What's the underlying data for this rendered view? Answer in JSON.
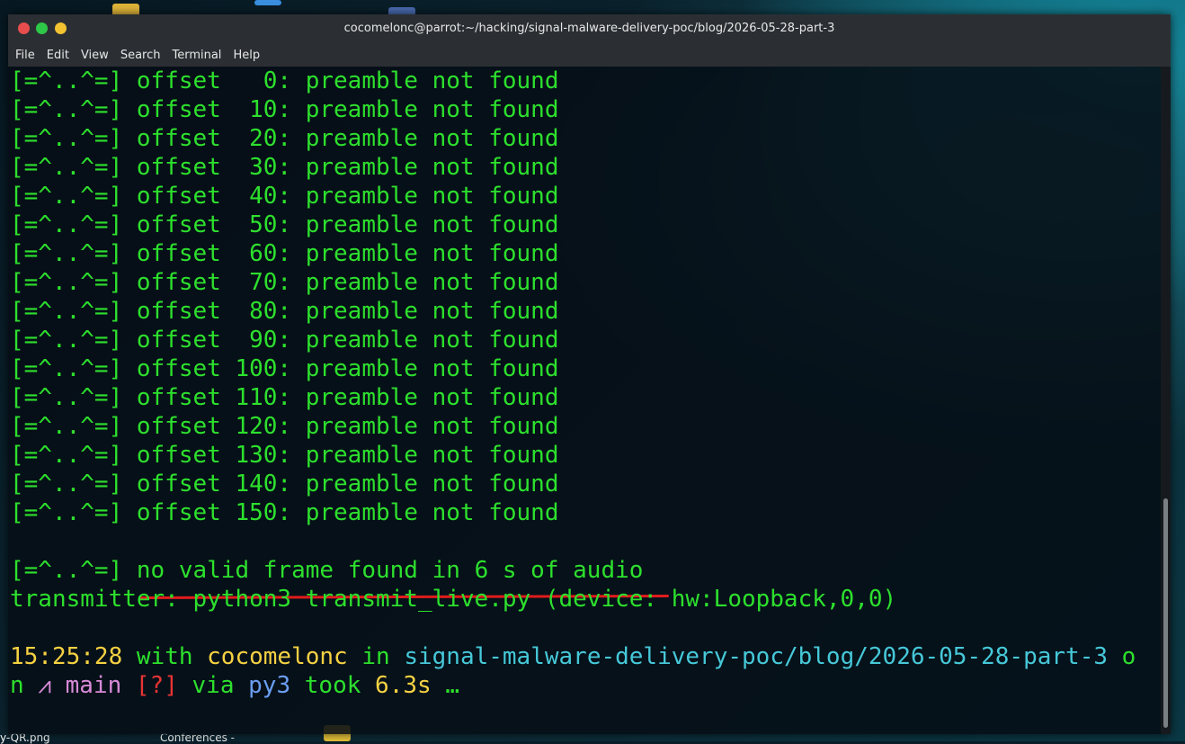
{
  "window": {
    "title": "cocomelonc@parrot:~/hacking/signal-malware-delivery-poc/blog/2026-05-28-part-3"
  },
  "menu": [
    "File",
    "Edit",
    "View",
    "Search",
    "Terminal",
    "Help"
  ],
  "desktop": {
    "labels": [
      "y-QR.png",
      "Conferences -"
    ]
  },
  "output_lines": [
    "[=^..^=] offset   0: preamble not found",
    "[=^..^=] offset  10: preamble not found",
    "[=^..^=] offset  20: preamble not found",
    "[=^..^=] offset  30: preamble not found",
    "[=^..^=] offset  40: preamble not found",
    "[=^..^=] offset  50: preamble not found",
    "[=^..^=] offset  60: preamble not found",
    "[=^..^=] offset  70: preamble not found",
    "[=^..^=] offset  80: preamble not found",
    "[=^..^=] offset  90: preamble not found",
    "[=^..^=] offset 100: preamble not found",
    "[=^..^=] offset 110: preamble not found",
    "[=^..^=] offset 120: preamble not found",
    "[=^..^=] offset 130: preamble not found",
    "[=^..^=] offset 140: preamble not found",
    "[=^..^=] offset 150: preamble not found"
  ],
  "result": {
    "prefix": "[=^..^=] ",
    "message": "no valid frame found in 6 s of audio"
  },
  "transmitter_line": "transmitter: python3 transmit_live.py (device: hw:Loopback,0,0)",
  "prompt": {
    "time": "15:25:28",
    "with": " with ",
    "user": "cocomelonc",
    "in": " in ",
    "path": "signal-malware-delivery-poc/blog/2026-05-28-part-3",
    "on": " o",
    "on2": "n ",
    "branch_icon": "⩘",
    "branch": " main ",
    "status": "[?]",
    "via": " via ",
    "lang": "py3",
    "took": " took ",
    "duration": "6.3s",
    "ellipsis": " …"
  },
  "colors": {
    "output_green": "#2de02d",
    "prompt_yellow": "#f5d142",
    "path_cyan": "#46c8d8",
    "branch_pink": "#d88ad8",
    "status_red": "#e83434",
    "underline_red": "#e01c1c"
  }
}
